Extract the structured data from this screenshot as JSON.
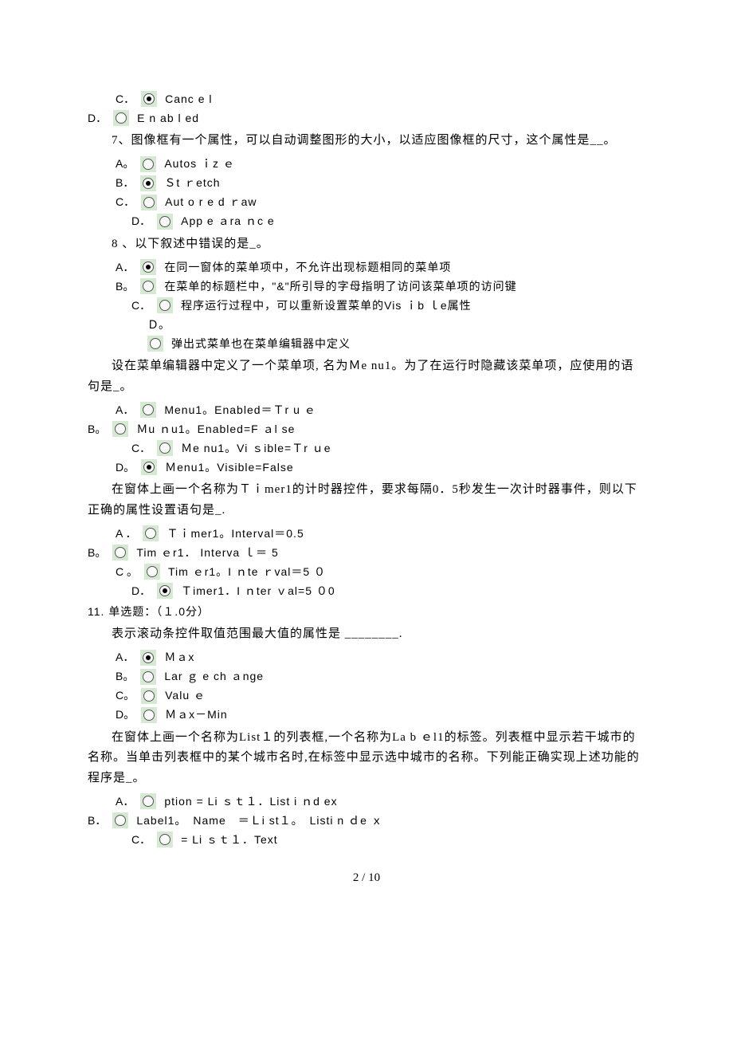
{
  "q6_tail": {
    "C": {
      "letter": "C．",
      "text": "Canc e l",
      "selected": true
    },
    "D": {
      "letter": "D．",
      "text": "E n ab l ed",
      "selected": false
    }
  },
  "q7": {
    "stem": "7、图像框有一个属性，可以自动调整图形的大小，以适应图像框的尺寸，这个属性是__。",
    "A": {
      "letter": "A。",
      "text": "Autos ｉz ｅ",
      "selected": false
    },
    "B": {
      "letter": "B．",
      "text": "Ｓt ｒetch",
      "selected": true
    },
    "C": {
      "letter": "C．",
      "text": "Aut o r e d ｒaw",
      "selected": false
    },
    "D": {
      "letter": "D．",
      "text": "App e ａra ｎc e",
      "selected": false
    }
  },
  "q8": {
    "stem": "8 、以下叙述中错误的是_。",
    "A": {
      "letter": "A．",
      "text": "在同一窗体的菜单项中，不允许出现标题相同的菜单项",
      "selected": true
    },
    "B": {
      "letter": "B。",
      "text": "在菜单的标题栏中，\"&\"所引导的字母指明了访问该菜单项的访问键",
      "selected": false
    },
    "C": {
      "letter": "C．",
      "text": "程序运行过程中，可以重新设置菜单的Vis ｉb ｌe属性",
      "selected": false
    },
    "D": {
      "letter": "Ｄ。",
      "text": "弹出式菜单也在菜单编辑器中定义",
      "selected": false
    }
  },
  "q9": {
    "stem": "设在菜单编辑器中定义了一个菜单项, 名为Ｍe nu1。为了在运行时隐藏该菜单项，应使用的语句是_。",
    "A": {
      "letter": "A．",
      "text": "Menu1。Enabled＝Ｔr u ｅ",
      "selected": false
    },
    "B": {
      "letter": "B。",
      "text": "Ｍu ｎu1。Enabled=F ａl se",
      "selected": false
    },
    "C": {
      "letter": "C．",
      "text": "Ｍe nu1。Vi ｓible=Ｔr ｕe",
      "selected": false
    },
    "D": {
      "letter": "D。",
      "text": "Ｍenu1。Visible=False",
      "selected": true
    }
  },
  "q10": {
    "stem": "在窗体上画一个名称为Ｔｉmer1的计时器控件，要求每隔0．5秒发生一次计时器事件，则以下正确的属性设置语句是_.",
    "A": {
      "letter": "A ．",
      "text": "Ｔｉmer1。Interval＝0.5",
      "selected": false
    },
    "B": {
      "letter": "B。",
      "text": "Tim ｅr1． Interva ｌ＝ 5",
      "selected": false
    },
    "C": {
      "letter": "C 。",
      "text": "Tim ｅr1。I ｎte ｒval＝5 ０",
      "selected": false
    },
    "D": {
      "letter": "D．",
      "text": "Ｔimer1．I ｎter ｖal=5 ０0",
      "selected": true
    }
  },
  "q11": {
    "header": "11. 单选题：（１.0分）",
    "stem": "表示滚动条控件取值范围最大值的属性是 ________.",
    "A": {
      "letter": "A．",
      "text": "Ｍａx",
      "selected": true
    },
    "B": {
      "letter": "B。",
      "text": "Lar ｇ e ch ａnge",
      "selected": false
    },
    "C": {
      "letter": "C。",
      "text": "Valu ｅ",
      "selected": false
    },
    "D": {
      "letter": "D。",
      "text": "Ｍａx－Min",
      "selected": false
    }
  },
  "q12": {
    "stem": "在窗体上画一个名称为List１的列表框,一个名称为La b ｅl1的标签。列表框中显示若干城市的名称。当单击列表框中的某个城市名时,在标签中显示选中城市的名称。下列能正确实现上述功能的程序是_。",
    "A": {
      "letter": "A．",
      "text": "ption = Li ｓｔ１．List i ｎd ex",
      "selected": false
    },
    "B": {
      "letter": "B．",
      "text": "Label1。　Name　＝Ｌi st１。　Listi n ｄe ｘ",
      "selected": false
    },
    "C": {
      "letter": "C．",
      "text": "= Li ｓｔ１．Text",
      "selected": false
    }
  },
  "footer": "2 / 10"
}
